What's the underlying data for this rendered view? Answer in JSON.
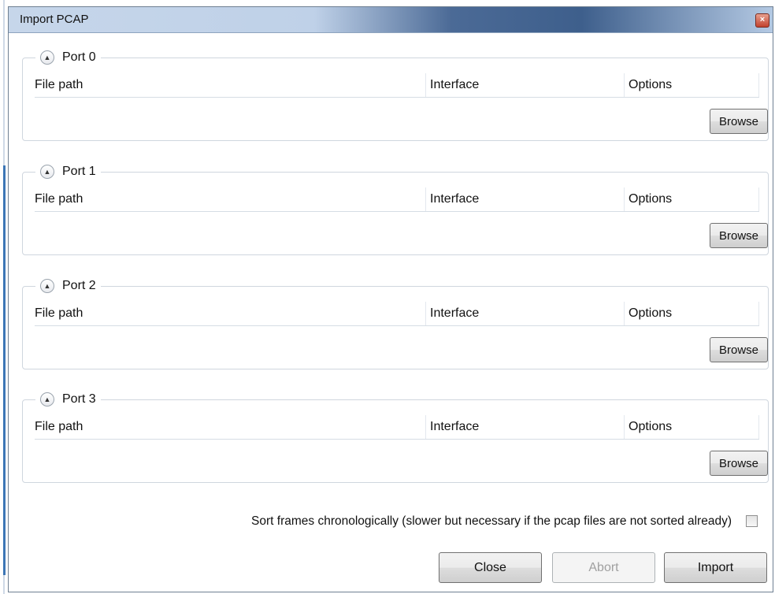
{
  "window": {
    "title": "Import PCAP",
    "close_glyph": "×"
  },
  "ports": [
    {
      "label": "Port  0",
      "columns": [
        "File path",
        "Interface",
        "Options"
      ],
      "browse_label": "Browse"
    },
    {
      "label": "Port  1",
      "columns": [
        "File path",
        "Interface",
        "Options"
      ],
      "browse_label": "Browse"
    },
    {
      "label": "Port  2",
      "columns": [
        "File path",
        "Interface",
        "Options"
      ],
      "browse_label": "Browse"
    },
    {
      "label": "Port  3",
      "columns": [
        "File path",
        "Interface",
        "Options"
      ],
      "browse_label": "Browse"
    }
  ],
  "sort_option": {
    "label": "Sort frames chronologically (slower but necessary if the pcap files are not sorted already)",
    "checked": false
  },
  "buttons": {
    "close": "Close",
    "abort": "Abort",
    "import": "Import"
  },
  "icons": {
    "expand": "chevron-up-icon",
    "window_close": "close-icon"
  }
}
